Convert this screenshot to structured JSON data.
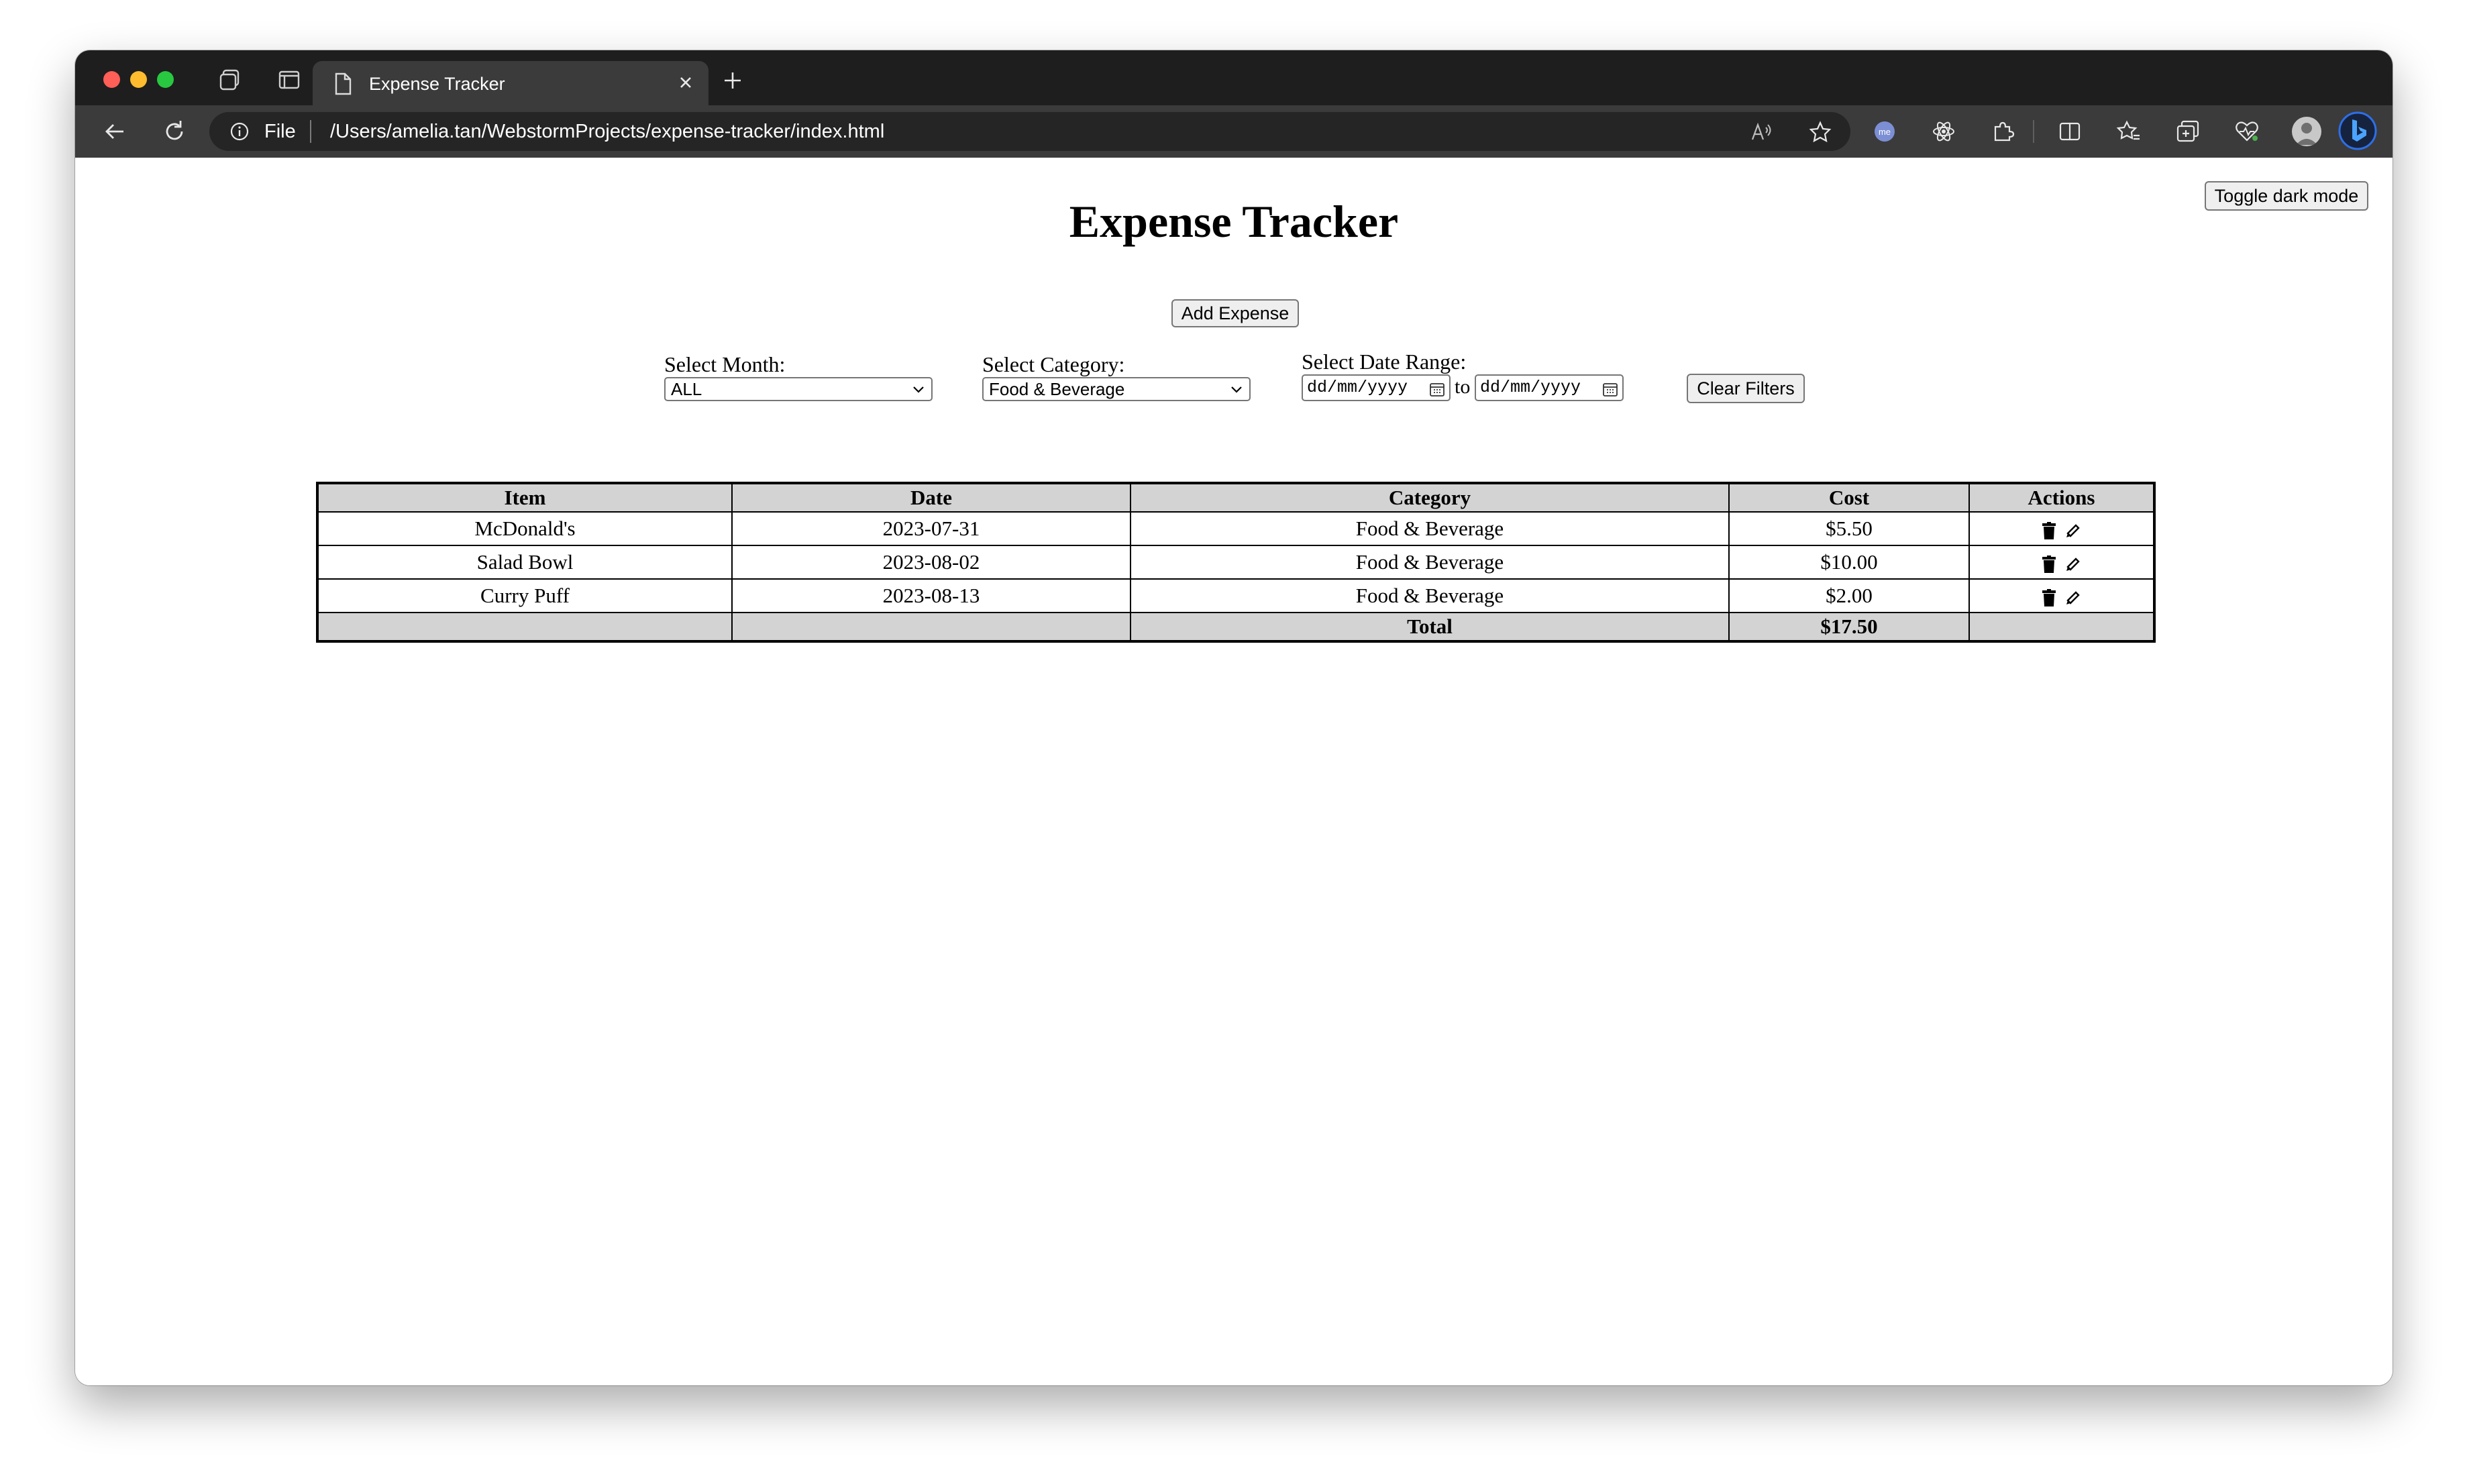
{
  "browser": {
    "tab_title": "Expense Tracker",
    "url_scheme_label": "File",
    "url": "/Users/amelia.tan/WebstormProjects/expense-tracker/index.html"
  },
  "page": {
    "title": "Expense Tracker",
    "dark_mode_button": "Toggle dark mode",
    "add_expense_button": "Add Expense",
    "clear_filters_button": "Clear Filters"
  },
  "filters": {
    "month_label": "Select Month:",
    "month_value": "ALL",
    "category_label": "Select Category:",
    "category_value": "Food & Beverage",
    "date_range_label": "Select Date Range:",
    "date_from_placeholder": "dd/mm/yyyy",
    "date_to_label": "to",
    "date_to_placeholder": "dd/mm/yyyy"
  },
  "table": {
    "headers": [
      "Item",
      "Date",
      "Category",
      "Cost",
      "Actions"
    ],
    "rows": [
      {
        "item": "McDonald's",
        "date": "2023-07-31",
        "category": "Food & Beverage",
        "cost": "$5.50"
      },
      {
        "item": "Salad Bowl",
        "date": "2023-08-02",
        "category": "Food & Beverage",
        "cost": "$10.00"
      },
      {
        "item": "Curry Puff",
        "date": "2023-08-13",
        "category": "Food & Beverage",
        "cost": "$2.00"
      }
    ],
    "total_label": "Total",
    "total_value": "$17.50"
  },
  "colors": {
    "header_background": "#d3d3d3",
    "browser_chrome": "#3b3b3b"
  }
}
